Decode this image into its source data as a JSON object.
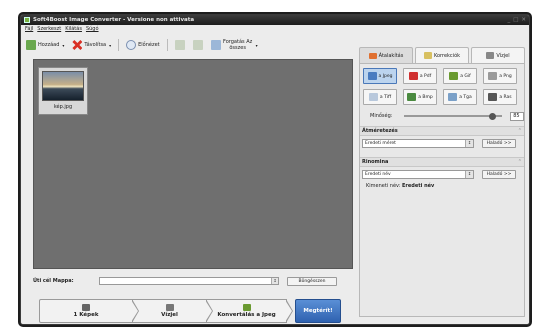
{
  "window": {
    "title": "Soft4Boost Image Converter - Versione non attivata",
    "controls": [
      "_",
      "□",
      "✕"
    ]
  },
  "menu": [
    "Fájl",
    "Szerkeszt",
    "Kilátás",
    "Súgó"
  ],
  "toolbar": {
    "add_label": "Hozzáad",
    "remove_label": "Távolítsa",
    "preview_label": "Előnézet",
    "rotate_label": "Forgatás Az összes"
  },
  "files": [
    {
      "name": "kép.jpg"
    }
  ],
  "tabs": {
    "conversion": "Átalakítás",
    "correction": "Korrekciók",
    "watermark": "Vízjel"
  },
  "formats": [
    "a Jpeg",
    "a Pdf",
    "a Gif",
    "a Png",
    "a Tiff",
    "a Bmp",
    "a Tga",
    "a Ras"
  ],
  "quality": {
    "label": "Minőség:",
    "value": "85"
  },
  "resize": {
    "header": "Átméretezés",
    "selected": "Eredeti méret",
    "advanced": "Haladó >>"
  },
  "rename": {
    "header": "Rinomina",
    "selected": "Eredeti név",
    "advanced": "Haladó >>",
    "new_name_label": "Kimeneti név:",
    "new_name_value": "Eredeti név"
  },
  "output": {
    "label": "Úti cél Mappa:",
    "value": "",
    "browse": "Böngésszen"
  },
  "steps": {
    "step1": "1 Képek",
    "step2": "Vízjel",
    "step3": "Konvertálás a Jpeg",
    "convert": "Megtérít!"
  },
  "colors": {
    "accent": "#2f62b0",
    "panel": "#6f6f6f",
    "titlebar": "#1c1c1c"
  }
}
